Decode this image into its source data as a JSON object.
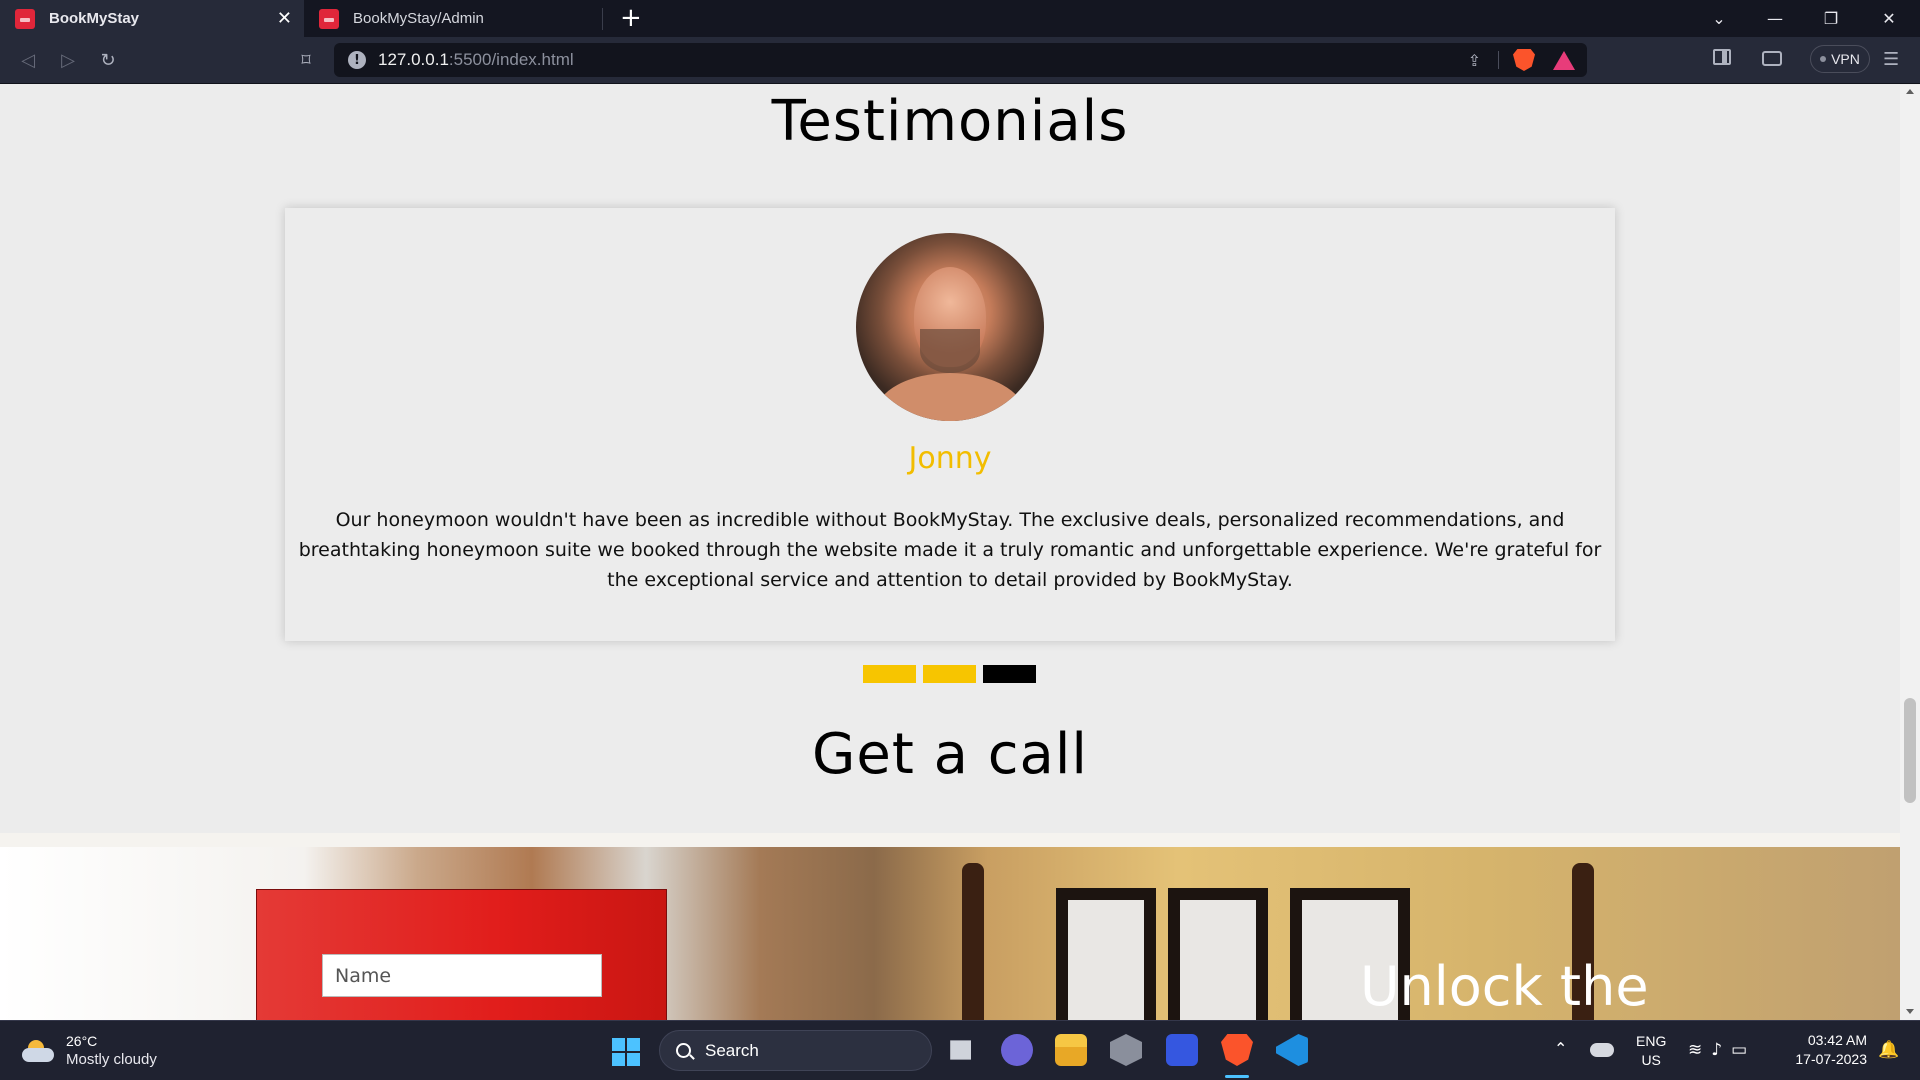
{
  "browser": {
    "tabs": [
      {
        "title": "BookMyStay",
        "active": true
      },
      {
        "title": "BookMyStay/Admin",
        "active": false
      }
    ],
    "address": {
      "host": "127.0.0.1",
      "rest": ":5500/index.html"
    },
    "vpn_label": "VPN"
  },
  "page": {
    "testimonials_title": "Testimonials",
    "testimonial": {
      "name": "Jonny",
      "quote": "Our honeymoon wouldn't have been as incredible without BookMyStay. The exclusive deals, personalized recommendations, and breathtaking honeymoon suite we booked through the website made it a truly romantic and unforgettable experience. We're grateful for the exceptional service and attention to detail provided by BookMyStay."
    },
    "carousel": {
      "count": 3,
      "active_index": 2
    },
    "call_title": "Get a call",
    "form": {
      "name_placeholder": "Name"
    },
    "hero_text": "Unlock the"
  },
  "colors": {
    "accent": "#f7c500",
    "form_bg": "#e11d1b"
  },
  "taskbar": {
    "weather": {
      "temp": "26°C",
      "condition": "Mostly cloudy"
    },
    "search_label": "Search",
    "lang": {
      "line1": "ENG",
      "line2": "US"
    },
    "clock": {
      "time": "03:42 AM",
      "date": "17-07-2023"
    }
  }
}
